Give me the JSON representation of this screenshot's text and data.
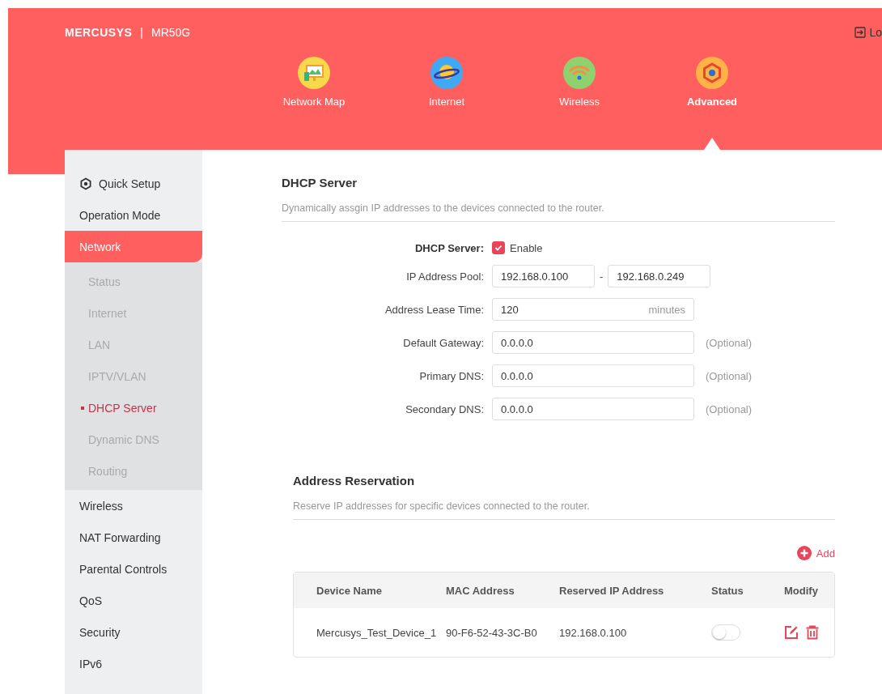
{
  "header": {
    "brand": "MERCUSYS",
    "divider": "|",
    "model": "MR50G",
    "logout": "Lo"
  },
  "nav": [
    {
      "label": "Network Map",
      "kind": "map",
      "selected": false
    },
    {
      "label": "Internet",
      "kind": "planet",
      "selected": false
    },
    {
      "label": "Wireless",
      "kind": "wifi",
      "selected": false
    },
    {
      "label": "Advanced",
      "kind": "gear",
      "selected": true
    }
  ],
  "sidebar": {
    "items": [
      {
        "label": "Quick Setup",
        "kind": "setup",
        "selected": false
      },
      {
        "label": "Operation Mode",
        "kind": "plain",
        "selected": false
      },
      {
        "label": "Network",
        "kind": "plain",
        "selected": true,
        "expanded": true,
        "children": [
          {
            "label": "Status",
            "selected": false
          },
          {
            "label": "Internet",
            "selected": false
          },
          {
            "label": "LAN",
            "selected": false
          },
          {
            "label": "IPTV/VLAN",
            "selected": false
          },
          {
            "label": "DHCP Server",
            "selected": true
          },
          {
            "label": "Dynamic DNS",
            "selected": false
          },
          {
            "label": "Routing",
            "selected": false
          }
        ]
      },
      {
        "label": "Wireless",
        "kind": "plain",
        "selected": false
      },
      {
        "label": "NAT Forwarding",
        "kind": "plain",
        "selected": false
      },
      {
        "label": "Parental Controls",
        "kind": "plain",
        "selected": false
      },
      {
        "label": "QoS",
        "kind": "plain",
        "selected": false
      },
      {
        "label": "Security",
        "kind": "plain",
        "selected": false
      },
      {
        "label": "IPv6",
        "kind": "plain",
        "selected": false
      }
    ]
  },
  "dhcp": {
    "title": "DHCP Server",
    "description": "Dynamically assgin IP addresses to the devices connected to the router.",
    "fields": [
      {
        "label": "DHCP Server:",
        "kind": "checkbox",
        "checked": true,
        "option": "Enable"
      },
      {
        "label": "IP Address Pool:",
        "kind": "range",
        "from": "192.168.0.100",
        "separator": "-",
        "to": "192.168.0.249"
      },
      {
        "label": "Address Lease Time:",
        "kind": "unit",
        "value": "120",
        "unit": "minutes"
      },
      {
        "label": "Default Gateway:",
        "kind": "text",
        "value": "0.0.0.0",
        "note": "(Optional)"
      },
      {
        "label": "Primary DNS:",
        "kind": "text",
        "value": "0.0.0.0",
        "note": "(Optional)"
      },
      {
        "label": "Secondary DNS:",
        "kind": "text",
        "value": "0.0.0.0",
        "note": "(Optional)"
      }
    ]
  },
  "reservation": {
    "title": "Address Reservation",
    "description": "Reserve IP addresses for specific devices connected to the router.",
    "add": "Add",
    "table": {
      "columns": [
        "Device Name",
        "MAC Address",
        "Reserved IP Address",
        "Status",
        "Modify"
      ],
      "rows": [
        {
          "cells": [
            "Mercusys_Test_Device_1",
            "90-F6-52-43-3C-B0",
            "192.168.0.100"
          ],
          "on": false
        }
      ]
    }
  }
}
